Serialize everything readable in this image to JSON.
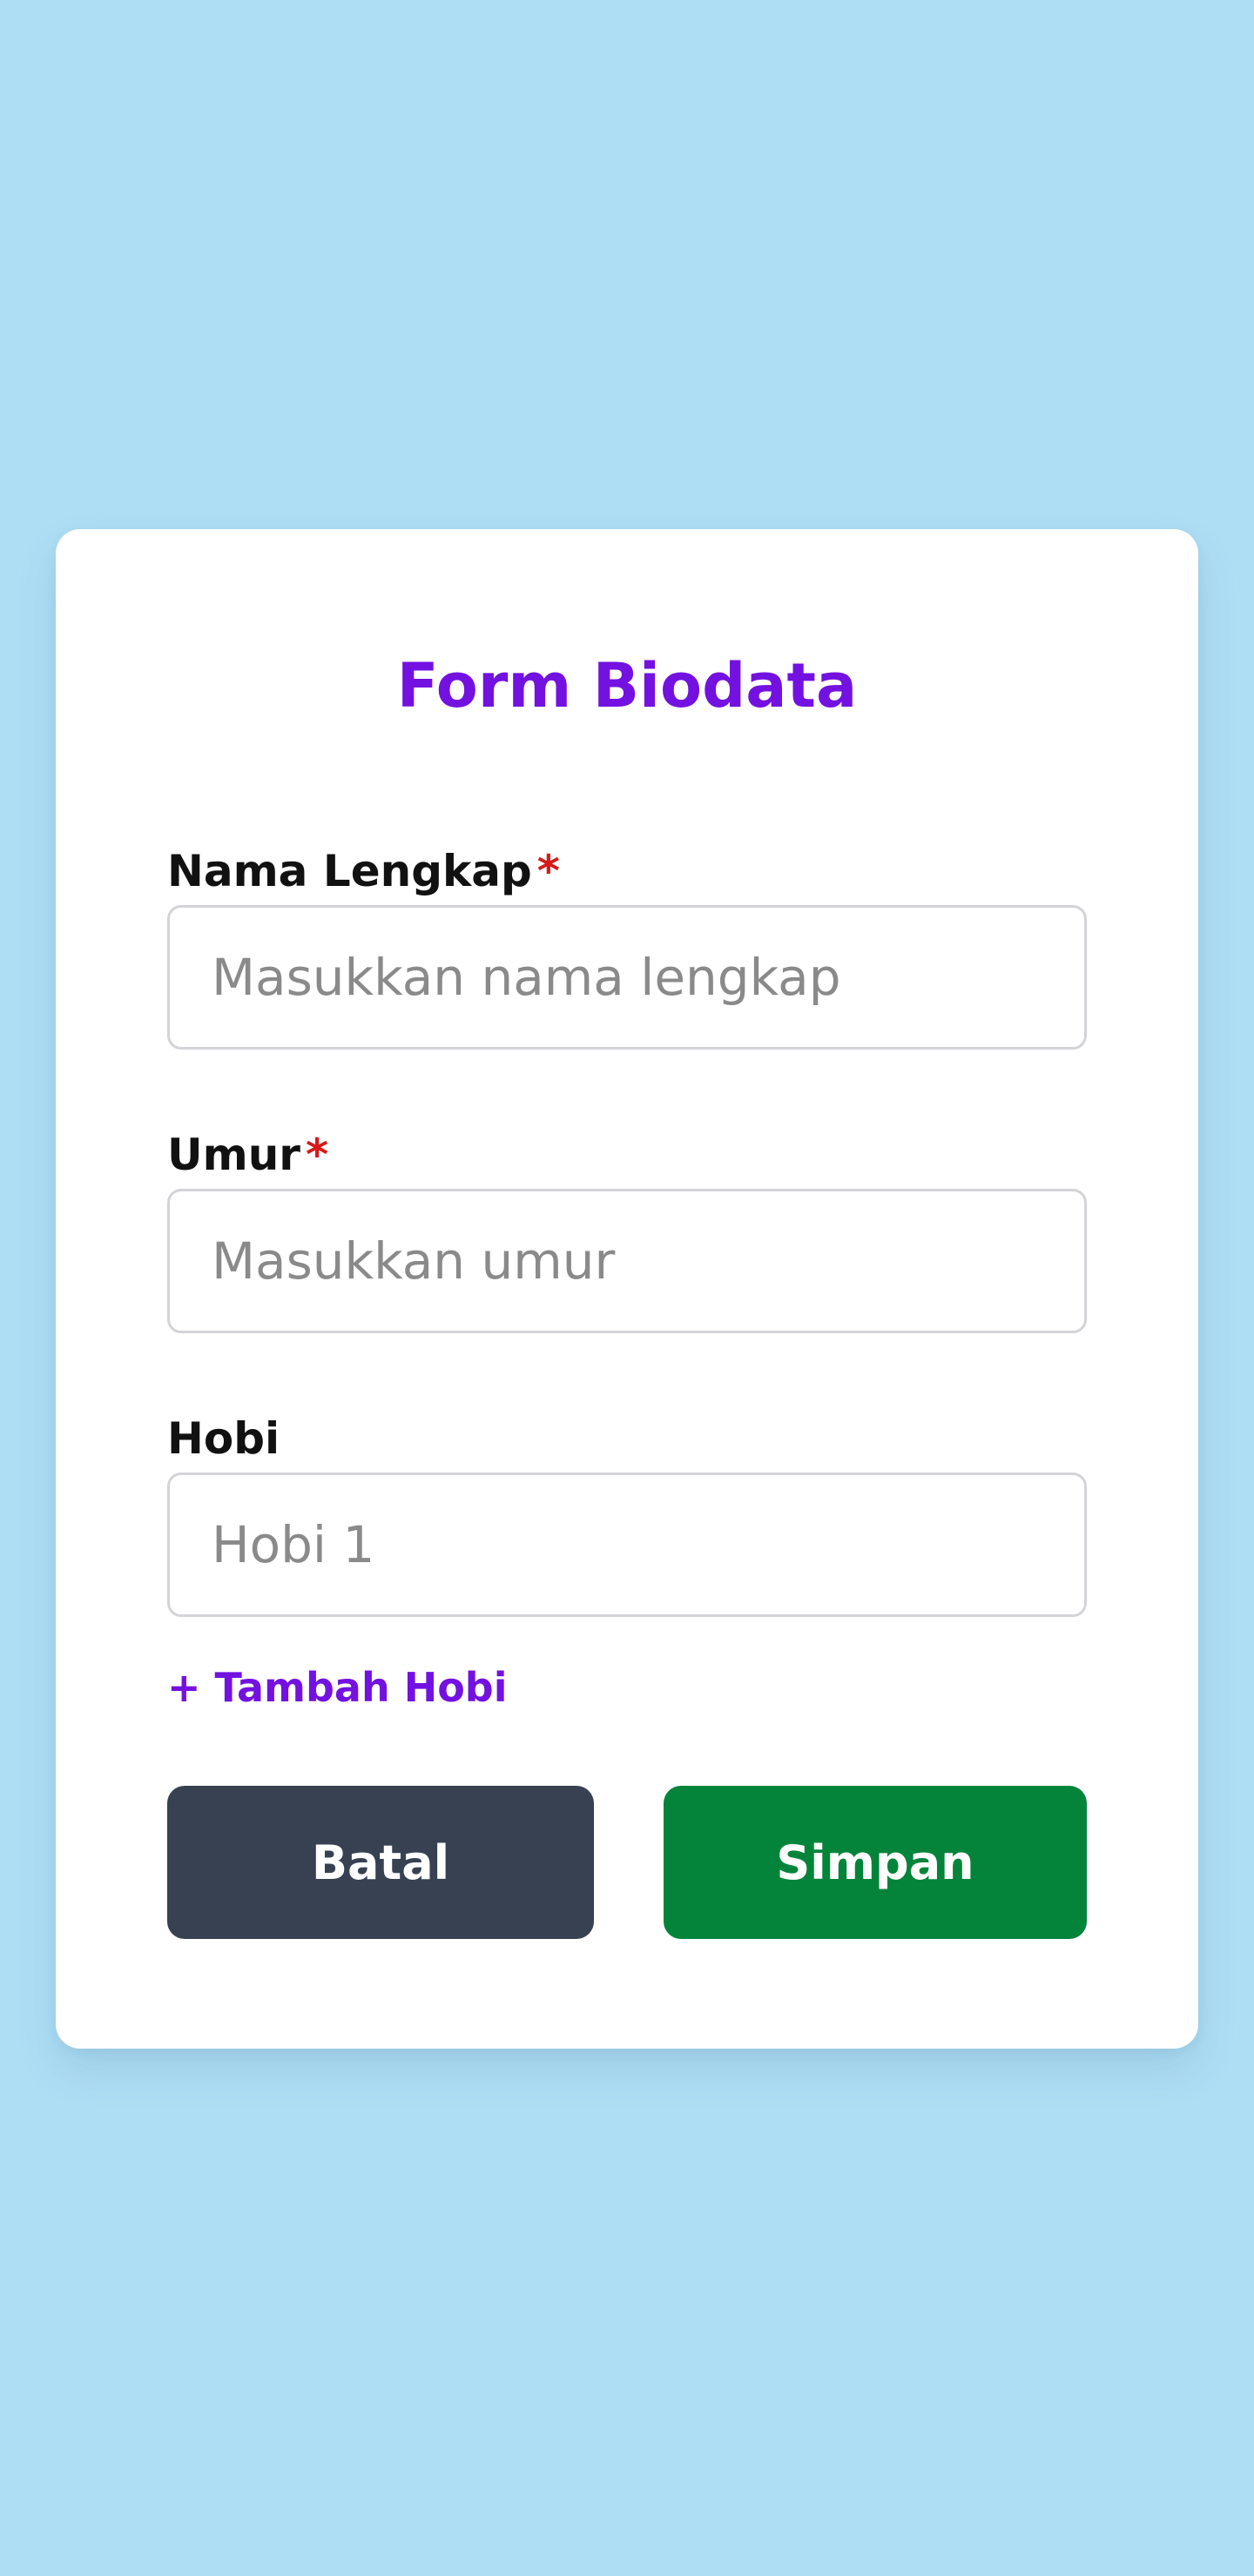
{
  "form": {
    "title": "Form Biodata",
    "fields": [
      {
        "label": "Nama Lengkap",
        "required_marker": "*",
        "placeholder": "Masukkan nama lengkap",
        "value": ""
      },
      {
        "label": "Umur",
        "required_marker": "*",
        "placeholder": "Masukkan umur",
        "value": ""
      },
      {
        "label": "Hobi",
        "placeholder": "Hobi 1",
        "value": ""
      }
    ],
    "add_hobby_label": "+ Tambah Hobi",
    "cancel_label": "Batal",
    "save_label": "Simpan"
  },
  "colors": {
    "background": "#aedef4",
    "accent": "#7311e0",
    "required": "#d61a1a",
    "cancel_button": "#374151",
    "save_button": "#03843a"
  }
}
